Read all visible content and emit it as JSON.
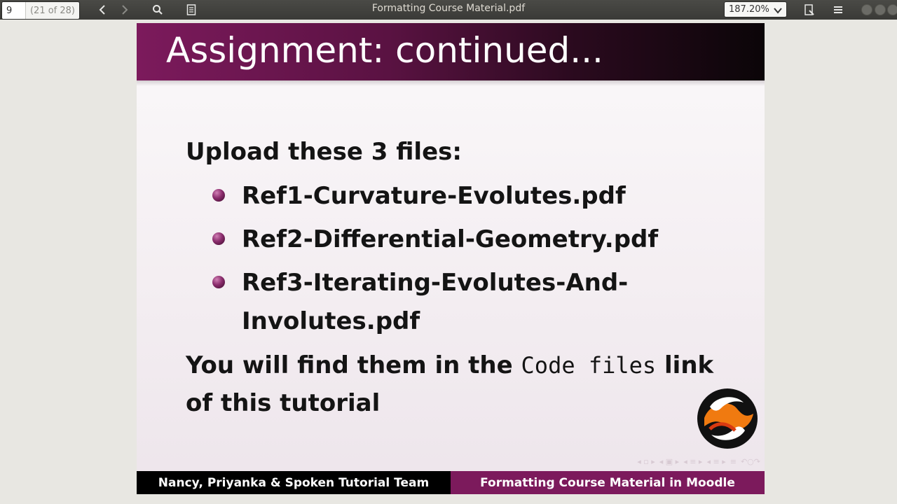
{
  "toolbar": {
    "page_value": "9",
    "page_count": "(21 of 28)",
    "title": "Formatting Course Material.pdf",
    "zoom": "187.20%"
  },
  "slide": {
    "title": "Assignment: continued...",
    "intro": "Upload these 3 files:",
    "bullets": [
      "Ref1-Curvature-Evolutes.pdf",
      "Ref2-Differential-Geometry.pdf",
      "Ref3-Iterating-Evolutes-And-Involutes.pdf"
    ],
    "outro_before": "You will find them in the ",
    "outro_code": "Code files",
    "outro_after": " link of this tutorial",
    "footer_left": "Nancy, Priyanka & Spoken Tutorial Team",
    "footer_right": "Formatting Course Material in Moodle"
  },
  "colors": {
    "accent": "#7c1a5c",
    "toolbar": "#3c3c39"
  }
}
